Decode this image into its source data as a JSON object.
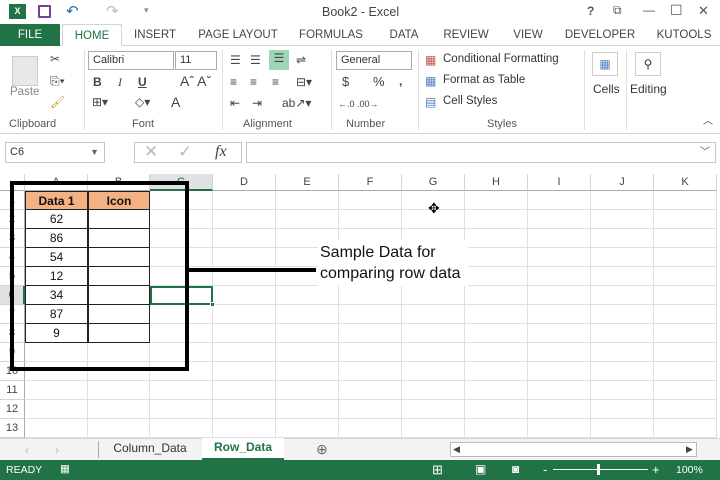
{
  "title": "Book2 - Excel",
  "title_icons": {
    "help": "?",
    "restore_ribbon": "⧉",
    "minimize": "—",
    "maximize": "☐",
    "close": "✕"
  },
  "tabs": [
    "FILE",
    "HOME",
    "INSERT",
    "PAGE LAYOUT",
    "FORMULAS",
    "DATA",
    "REVIEW",
    "VIEW",
    "DEVELOPER",
    "KUTOOLS"
  ],
  "ribbon": {
    "paste": "Paste",
    "font_name": "Calibri",
    "font_size": "11",
    "number_format": "General",
    "bold": "B",
    "italic": "I",
    "underline": "U",
    "font_color": "A",
    "currency": "$",
    "percent": "%",
    "comma": ",",
    "conditional_formatting": "Conditional Formatting",
    "format_as_table": "Format as Table",
    "cell_styles": "Cell Styles",
    "cells": "Cells",
    "editing": "Editing",
    "groups": [
      "Clipboard",
      "Font",
      "Alignment",
      "Number",
      "Styles"
    ]
  },
  "formula_bar": {
    "name_box": "C6",
    "fx": "fx",
    "value": ""
  },
  "columns": [
    "A",
    "B",
    "C",
    "D",
    "E",
    "F",
    "G",
    "H",
    "I",
    "J",
    "K"
  ],
  "rows": [
    "1",
    "2",
    "3",
    "4",
    "5",
    "6",
    "7",
    "8",
    "9",
    "10",
    "11",
    "12",
    "13"
  ],
  "table": {
    "headers": [
      "Data 1",
      "Icon"
    ],
    "values": [
      "62",
      "86",
      "54",
      "12",
      "34",
      "87",
      "9"
    ]
  },
  "header_color": "#f4b183",
  "accent": "#217346",
  "annotation": "Sample Data for comparing row data",
  "sheets": [
    "Column_Data",
    "Row_Data"
  ],
  "status": {
    "ready": "READY",
    "zoom": "100%",
    "zoom_minus": "-",
    "zoom_plus": "+"
  }
}
